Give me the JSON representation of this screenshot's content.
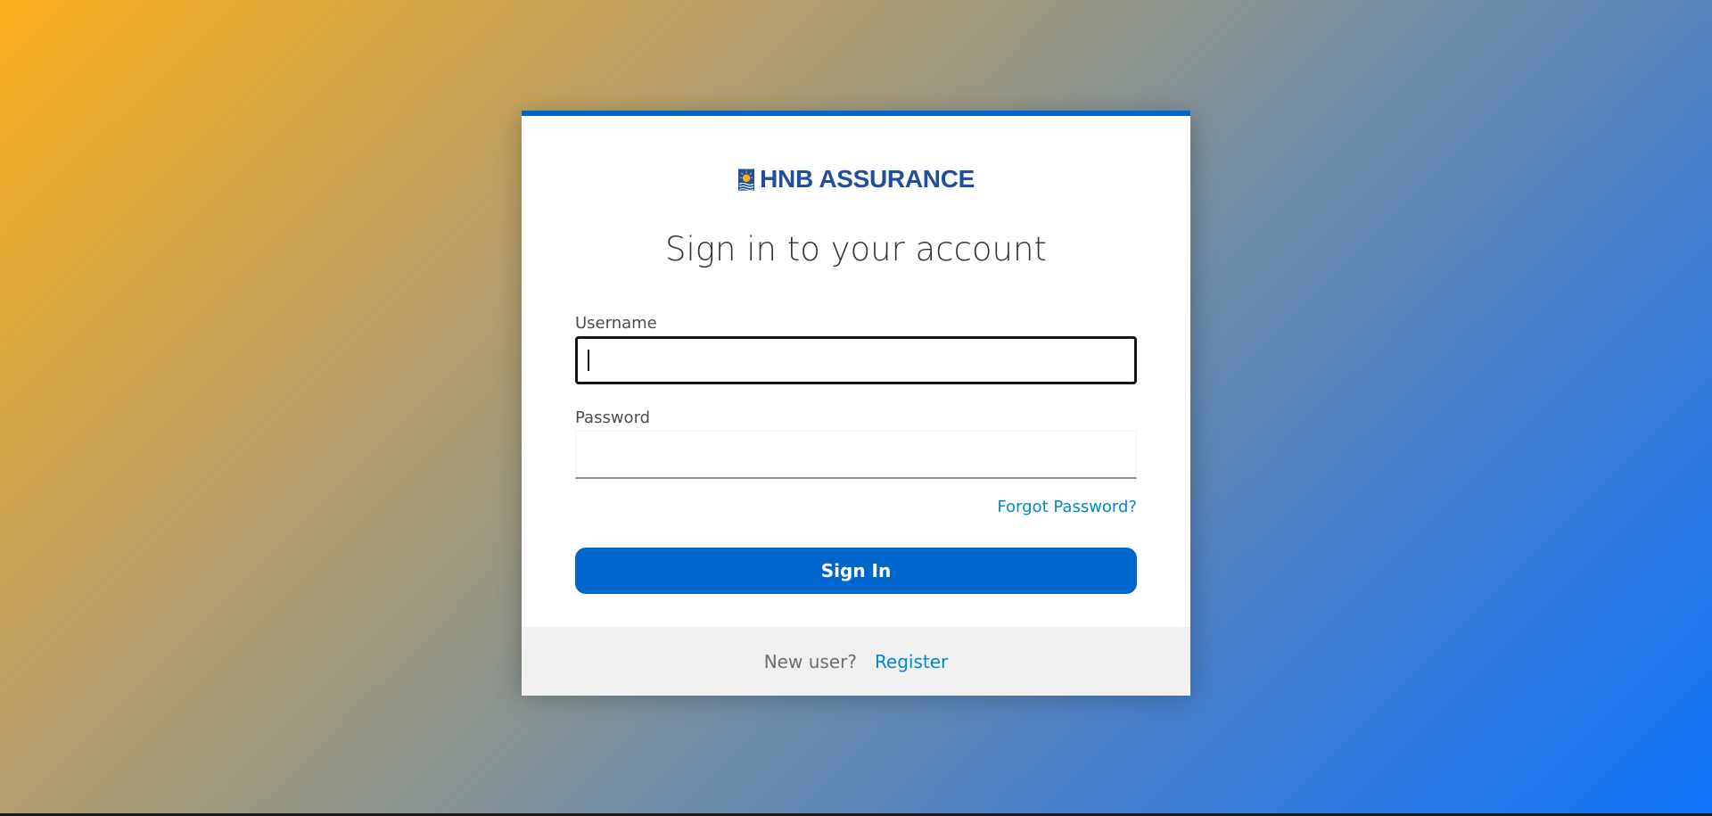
{
  "logo": {
    "text": "HNB ASSURANCE",
    "emblem_icon": "sun-over-waves-emblem",
    "colors": {
      "text": "#1f4e9c",
      "sun": "#f6b31b"
    }
  },
  "login": {
    "title": "Sign in to your account",
    "username_label": "Username",
    "username_value": "",
    "password_label": "Password",
    "password_value": "",
    "forgot_password": "Forgot Password?",
    "sign_in": "Sign In"
  },
  "footer": {
    "new_user": "New user?",
    "register": "Register"
  },
  "colors": {
    "accent": "#0066cc",
    "link": "#0088ce",
    "background_start": "#fbae1a",
    "background_end": "#0f72fb"
  }
}
